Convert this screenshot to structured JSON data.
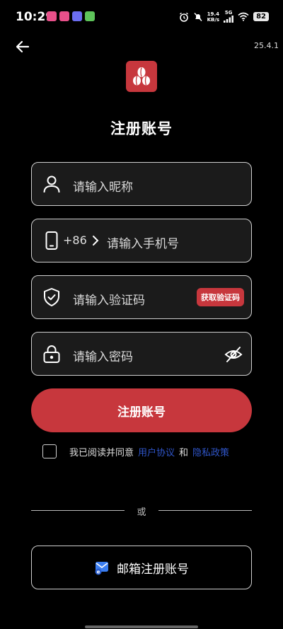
{
  "status_bar": {
    "time": "10:29",
    "net_speed_value": "19.4",
    "net_speed_unit": "KB/s",
    "network": "5G",
    "battery": "82"
  },
  "header": {
    "version": "25.4.1",
    "title": "注册账号"
  },
  "form": {
    "nickname_placeholder": "请输入昵称",
    "country_code": "+86",
    "phone_placeholder": "请输入手机号",
    "code_placeholder": "请输入验证码",
    "get_code_label": "获取验证码",
    "password_placeholder": "请输入密码"
  },
  "register_button_label": "注册账号",
  "agreement": {
    "prefix": "我已阅读并同意",
    "user_agreement": "用户协议",
    "and": "和",
    "privacy_policy": "隐私政策"
  },
  "divider_text": "或",
  "email_register_label": "邮箱注册账号",
  "colors": {
    "accent": "#c7373d",
    "link": "#2f55c8",
    "background": "#000000",
    "field_border": "#d0d0d0"
  },
  "icons": [
    "back-arrow-icon",
    "app-logo",
    "user-icon",
    "phone-icon",
    "chevron-right-icon",
    "shield-check-icon",
    "lock-icon",
    "eye-off-icon",
    "mail-icon"
  ]
}
